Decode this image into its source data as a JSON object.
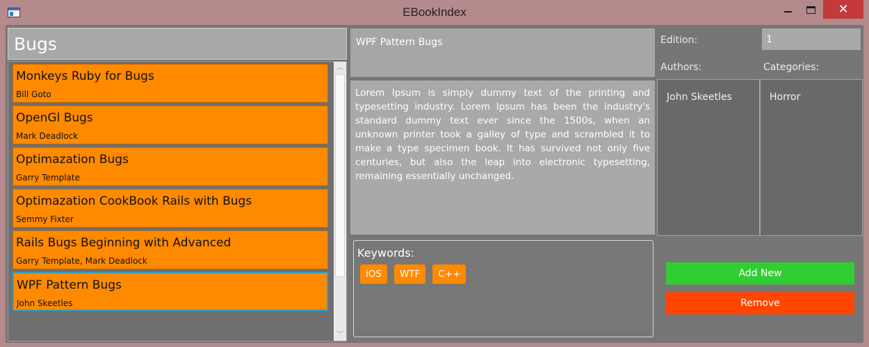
{
  "window": {
    "title": "EBookIndex",
    "close_glyph": "✕"
  },
  "list": {
    "header": "Bugs",
    "items": [
      {
        "title": "Monkeys Ruby for Bugs",
        "authors": "Bill Goto"
      },
      {
        "title": "OpenGl Bugs",
        "authors": "Mark Deadlock"
      },
      {
        "title": "Optimazation Bugs",
        "authors": "Garry Template"
      },
      {
        "title": "Optimazation CookBook Rails with Bugs",
        "authors": "Semmy Fixter"
      },
      {
        "title": "Rails Bugs Beginning with Advanced",
        "authors": "Garry Template, Mark Deadlock"
      },
      {
        "title": "WPF Pattern Bugs",
        "authors": "John Skeetles"
      }
    ],
    "selected_index": 5
  },
  "detail": {
    "title": "WPF Pattern Bugs",
    "description": "Lorem Ipsum is simply dummy text of the printing and typesetting industry. Lorem Ipsum has been the industry's standard dummy text ever since the 1500s, when an unknown printer took a galley of type and scrambled it to make a type specimen book. It has survived not only five centuries, but also the leap into electronic typesetting, remaining essentially unchanged.",
    "keywords_label": "Keywords:",
    "keywords": [
      "iOS",
      "WTF",
      "C++"
    ],
    "edition_label": "Edition:",
    "edition_value": "1",
    "authors_label": "Authors:",
    "authors": [
      "John Skeetles"
    ],
    "categories_label": "Categories:",
    "categories": [
      "Horror"
    ]
  },
  "buttons": {
    "add_new": "Add New",
    "remove": "Remove"
  },
  "colors": {
    "item_bg": "#ff8a00",
    "add_button": "#32cd32",
    "remove_button": "#ff4500",
    "selection_border": "#2fa3c8"
  }
}
